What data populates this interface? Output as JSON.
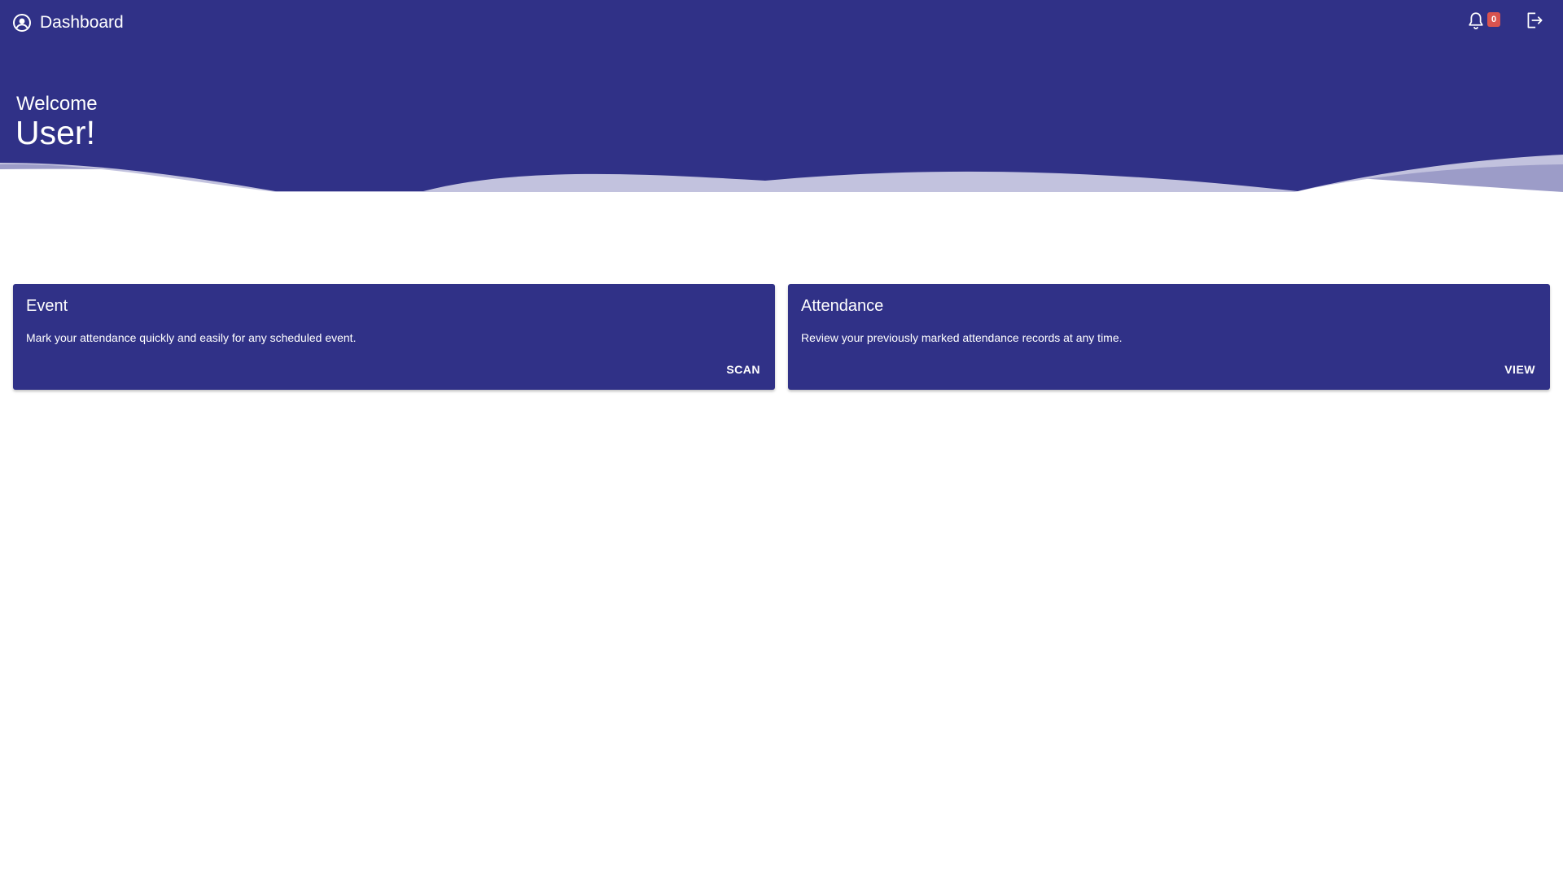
{
  "colors": {
    "primary": "#303187",
    "badge": "#d9534f",
    "text": "#ffffff"
  },
  "header": {
    "title": "Dashboard",
    "icons": {
      "profile": "user-circle-icon",
      "notifications": "bell-icon",
      "logout": "logout-icon"
    },
    "notification_count": "0",
    "welcome_label": "Welcome",
    "user_name": "User!"
  },
  "cards": [
    {
      "title": "Event",
      "description": "Mark your attendance quickly and easily for any scheduled event.",
      "action_label": "SCAN"
    },
    {
      "title": "Attendance",
      "description": "Review your previously marked attendance records at any time.",
      "action_label": "VIEW"
    }
  ]
}
